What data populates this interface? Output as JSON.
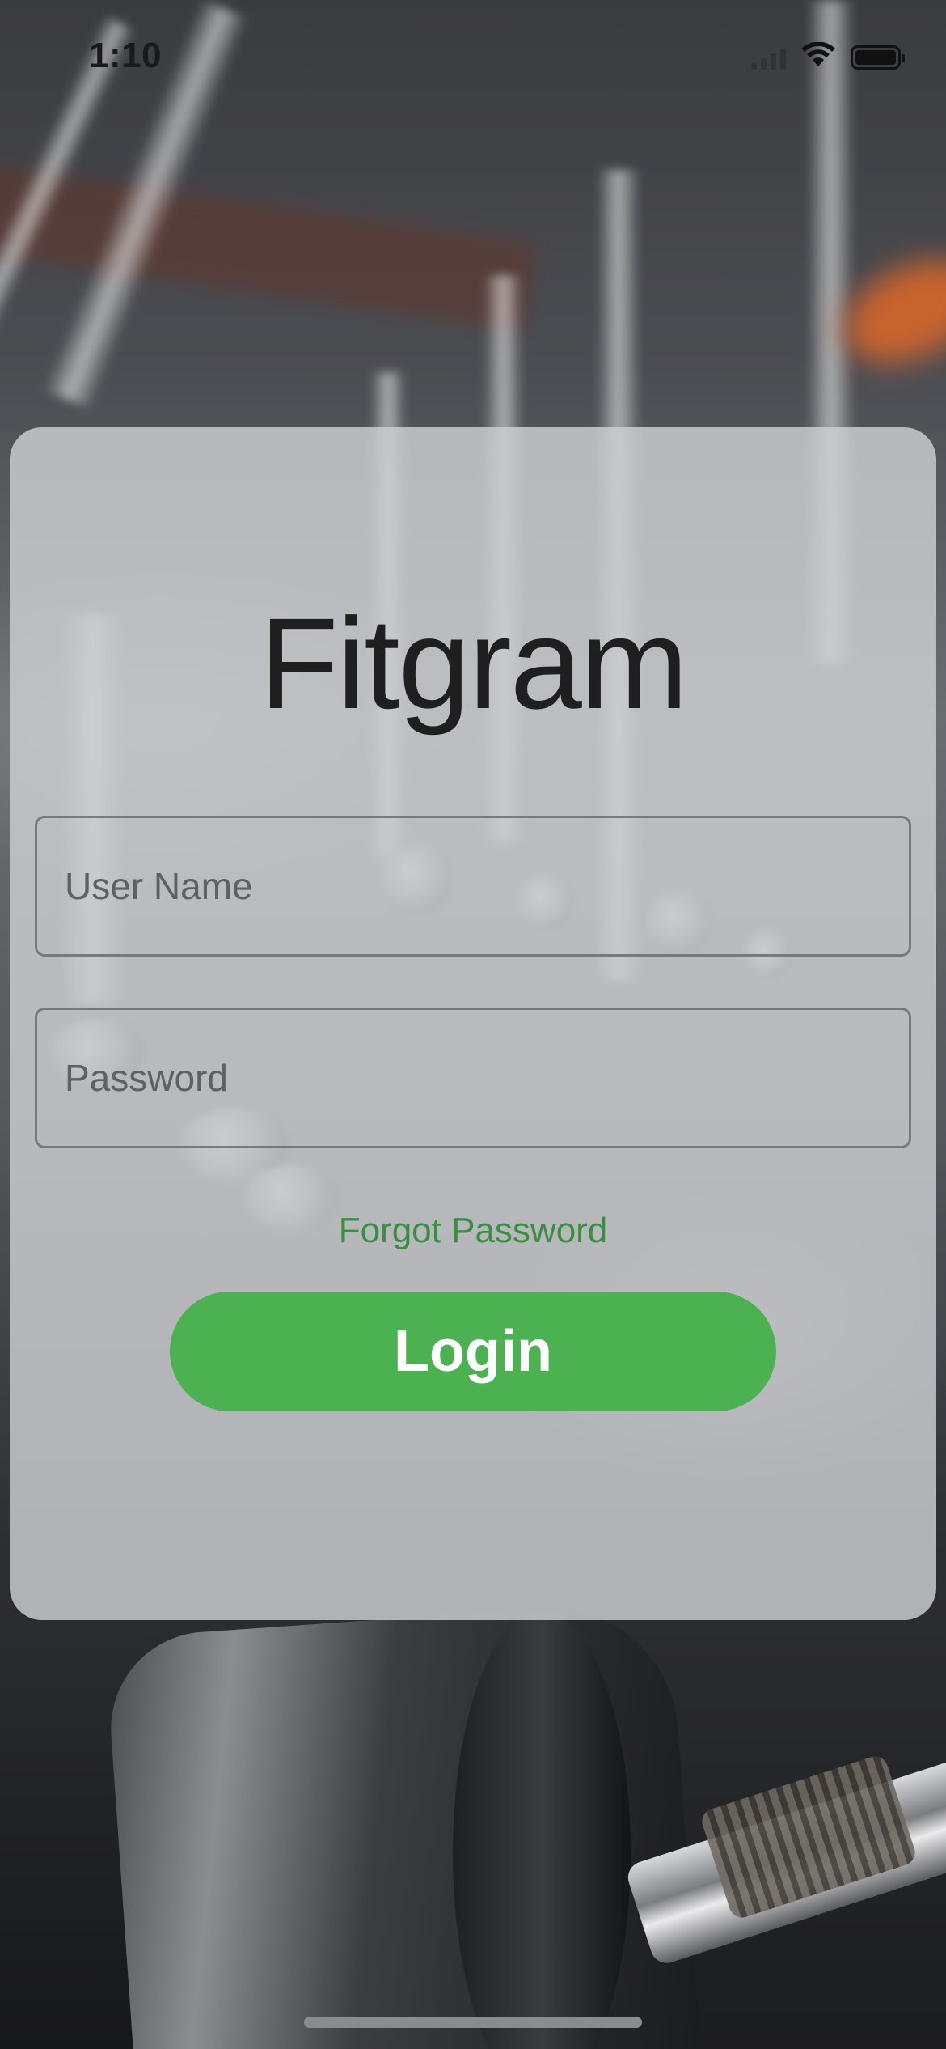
{
  "status_bar": {
    "time": "1:10"
  },
  "app": {
    "title": "Fitgram"
  },
  "form": {
    "username": {
      "placeholder": "User Name",
      "value": ""
    },
    "password": {
      "placeholder": "Password",
      "value": ""
    },
    "forgot_password_label": "Forgot Password",
    "login_label": "Login"
  },
  "colors": {
    "accent": "#4cb150",
    "link": "#3a8f3f",
    "title_text": "#1f1f1f"
  },
  "icons": {
    "status": [
      "cellular-signal-icon",
      "wifi-icon",
      "battery-icon"
    ]
  }
}
